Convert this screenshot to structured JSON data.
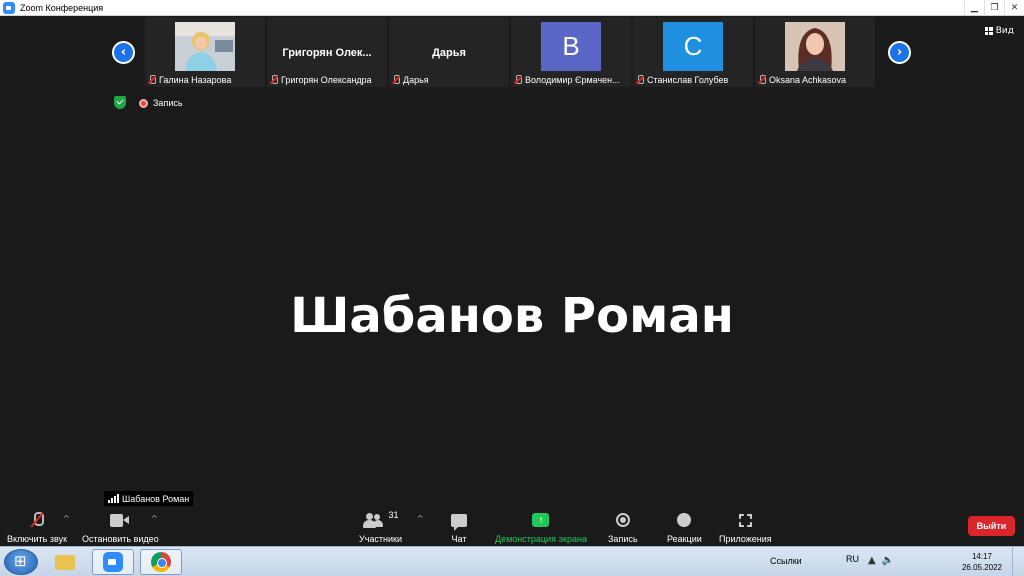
{
  "window": {
    "title": "Zoom Конференция",
    "minimize": "▁",
    "restore": "❐",
    "close": "✕"
  },
  "strip": {
    "prev": "‹",
    "next": "›",
    "view_label": "Вид",
    "participants": [
      {
        "caption": "Галина Назарова",
        "kind": "photo",
        "center": ""
      },
      {
        "caption": "Григорян Олександра",
        "kind": "name",
        "center": "Григорян  Олек..."
      },
      {
        "caption": "Дарья",
        "kind": "name",
        "center": "Дарья"
      },
      {
        "caption": "Володимир Єрмачен...",
        "kind": "letter",
        "center": "B",
        "color": "#5b67c7"
      },
      {
        "caption": "Станислав Голубев",
        "kind": "letter",
        "center": "C",
        "color": "#1f8fe0"
      },
      {
        "caption": "Oksana Achkasova",
        "kind": "photo",
        "center": ""
      }
    ]
  },
  "recording": {
    "label": "Запись"
  },
  "speaker": {
    "name": "Шабанов Роман",
    "tag": "Шабанов Роман"
  },
  "toolbar": {
    "unmute": "Включить звук",
    "stop_video": "Остановить видео",
    "participants": "Участники",
    "participants_count": "31",
    "chat": "Чат",
    "share": "Демонстрация экрана",
    "share_arrow": "↑",
    "record": "Запись",
    "reactions": "Реакции",
    "apps": "Приложения",
    "leave": "Выйти",
    "caret": "^"
  },
  "taskbar": {
    "links": "Ссылки",
    "lang": "RU",
    "time": "14:17",
    "date": "26.05.2022",
    "tray_up": "▲",
    "volume": "🔈"
  },
  "colors": {
    "accent_blue": "#1a73e8",
    "share_green": "#22c95a",
    "leave_red": "#d8262c",
    "bg": "#1a1a1a"
  }
}
